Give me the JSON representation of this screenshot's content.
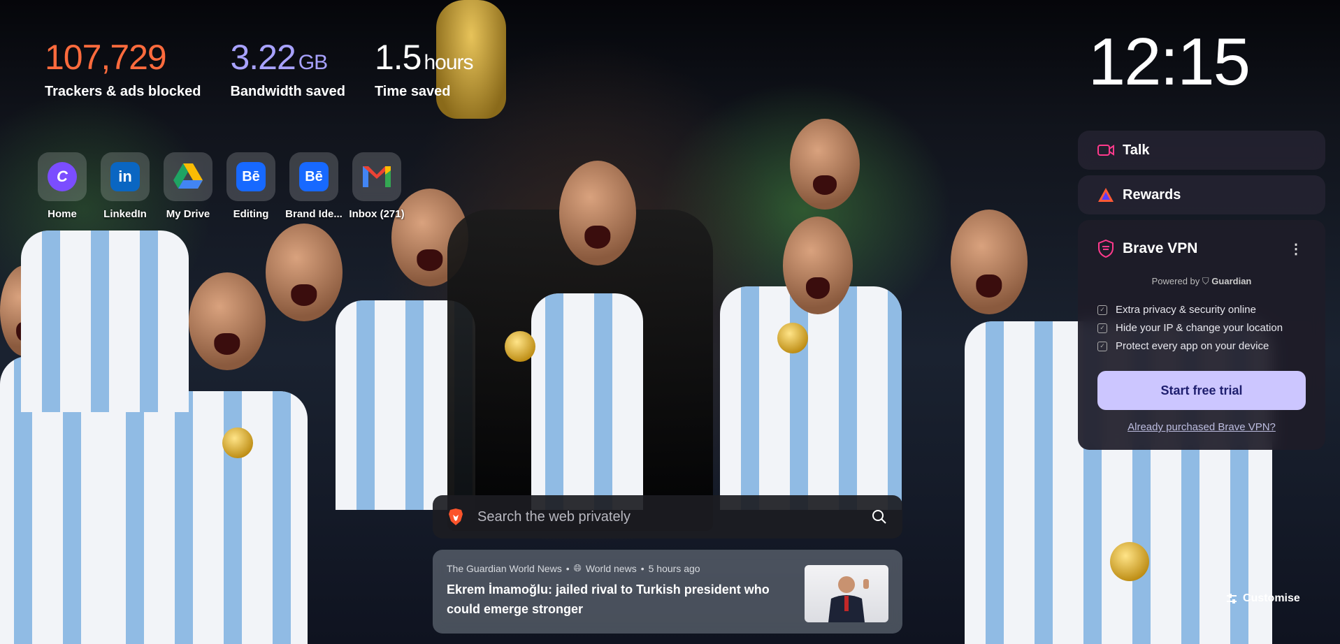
{
  "stats": [
    {
      "value": "107,729",
      "unit": "",
      "label": "Trackers & ads blocked",
      "color": "#ff6b3d"
    },
    {
      "value": "3.22",
      "unit": "GB",
      "label": "Bandwidth saved",
      "color": "#a8a2ff"
    },
    {
      "value": "1.5",
      "unit": "hours",
      "label": "Time saved",
      "color": "#ffffff"
    }
  ],
  "clock": "12:15",
  "top_sites": [
    {
      "name": "Home",
      "icon": "canva-icon",
      "glyph": "C",
      "color": "#7b4dff"
    },
    {
      "name": "LinkedIn",
      "icon": "linkedin-icon",
      "glyph": "in",
      "color": "#0a66c2"
    },
    {
      "name": "My Drive",
      "icon": "google-drive-icon",
      "glyph": "▲",
      "color": "#1fa463"
    },
    {
      "name": "Editing",
      "icon": "behance-icon",
      "glyph": "Bē",
      "color": "#1769ff"
    },
    {
      "name": "Brand Ide...",
      "icon": "behance-icon",
      "glyph": "Bē",
      "color": "#1769ff"
    },
    {
      "name": "Inbox (271)",
      "icon": "gmail-icon",
      "glyph": "M",
      "color": "#ea4335"
    }
  ],
  "widget": {
    "talk": "Talk",
    "rewards": "Rewards",
    "vpn": {
      "title": "Brave VPN",
      "powered_by": "Powered by",
      "powered_brand": "Guardian",
      "features": [
        "Extra privacy & security online",
        "Hide your IP & change your location",
        "Protect every app on your device"
      ],
      "cta": "Start free trial",
      "already": "Already purchased Brave VPN?"
    }
  },
  "search": {
    "placeholder": "Search the web privately"
  },
  "news": {
    "source": "The Guardian World News",
    "category": "World news",
    "time": "5 hours ago",
    "headline": "Ekrem İmamoğlu: jailed rival to Turkish president who could emerge stronger"
  },
  "customise": "Customise"
}
